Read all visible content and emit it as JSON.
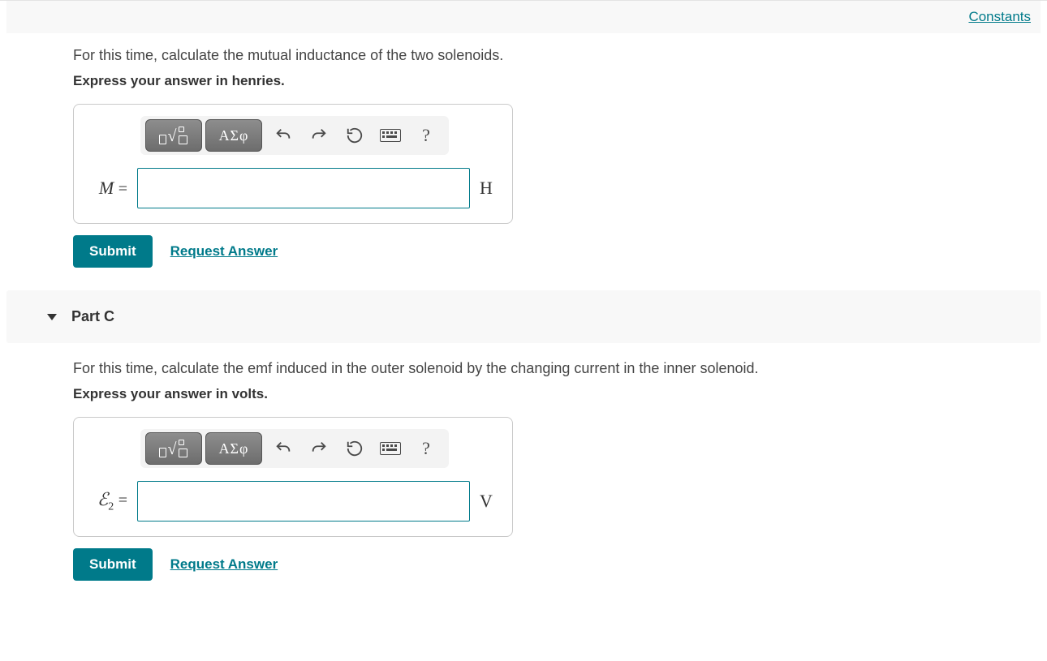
{
  "header": {
    "constants_link": "Constants"
  },
  "toolbar": {
    "greek_label": "ΑΣφ",
    "help_label": "?"
  },
  "buttons": {
    "submit": "Submit",
    "request_answer": "Request Answer"
  },
  "parts": {
    "b": {
      "question": "For this time, calculate the mutual inductance of the two solenoids.",
      "instruction": "Express your answer in henries.",
      "variable_html": "M",
      "unit": "H",
      "value": ""
    },
    "c": {
      "header": "Part C",
      "question": "For this time, calculate the emf induced in the outer solenoid by the changing current in the inner solenoid.",
      "instruction": "Express your answer in volts.",
      "variable_html": "ℰ",
      "variable_sub": "2",
      "unit": "V",
      "value": ""
    }
  }
}
